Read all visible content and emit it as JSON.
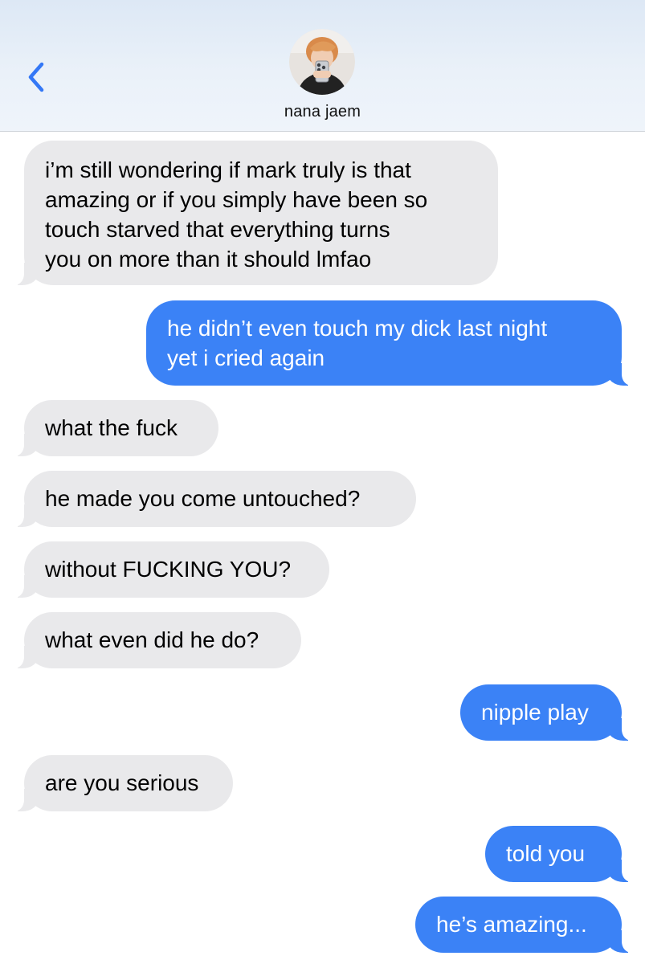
{
  "header": {
    "contact_name": "nana jaem",
    "back_icon": "chevron-left-icon",
    "accent_color": "#3478f6"
  },
  "colors": {
    "incoming_bubble": "#e9e9eb",
    "outgoing_bubble": "#3b82f6"
  },
  "messages": [
    {
      "direction": "incoming",
      "lines": [
        "i’m still wondering if mark truly is that",
        "amazing or if you simply have been so",
        "touch starved that everything turns",
        "you on more than it should lmfao"
      ]
    },
    {
      "direction": "outgoing",
      "lines": [
        "he didn’t even touch my dick last night",
        "yet i cried again"
      ]
    },
    {
      "direction": "incoming",
      "lines": [
        "what the fuck"
      ]
    },
    {
      "direction": "incoming",
      "lines": [
        "he made you come untouched?"
      ]
    },
    {
      "direction": "incoming",
      "lines": [
        "without FUCKING YOU?"
      ]
    },
    {
      "direction": "incoming",
      "lines": [
        "what even did he do?"
      ]
    },
    {
      "direction": "outgoing",
      "lines": [
        "nipple play"
      ]
    },
    {
      "direction": "incoming",
      "lines": [
        "are you serious"
      ]
    },
    {
      "direction": "outgoing",
      "lines": [
        "told you"
      ]
    },
    {
      "direction": "outgoing",
      "lines": [
        "he’s amazing..."
      ]
    }
  ]
}
